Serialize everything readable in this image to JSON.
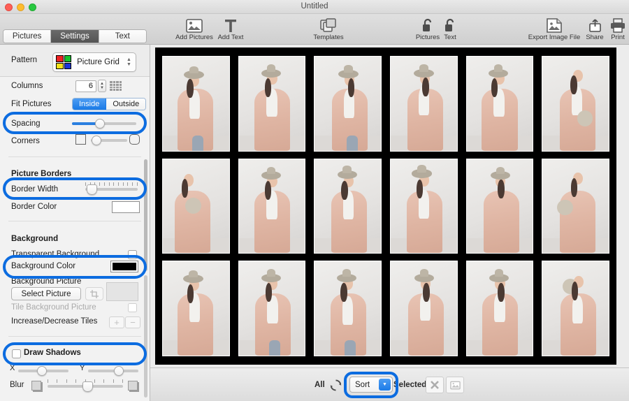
{
  "window": {
    "title": "Untitled",
    "traffic_lights": [
      "close",
      "minimize",
      "zoom"
    ]
  },
  "toolbar": {
    "items": [
      {
        "label": "Add Pictures",
        "icon": "picture-icon"
      },
      {
        "label": "Add Text",
        "icon": "text-t-icon"
      },
      {
        "label": "Templates",
        "icon": "templates-icon"
      },
      {
        "label": "Pictures",
        "icon": "unlock-icon"
      },
      {
        "label": "Text",
        "icon": "unlock-icon"
      },
      {
        "label": "Export Image File",
        "icon": "export-image-icon"
      },
      {
        "label": "Share",
        "icon": "share-icon"
      },
      {
        "label": "Print",
        "icon": "printer-icon"
      }
    ]
  },
  "sidebar": {
    "tabs": [
      {
        "label": "Pictures",
        "active": false
      },
      {
        "label": "Settings",
        "active": true
      },
      {
        "label": "Text",
        "active": false
      }
    ],
    "pattern": {
      "label": "Pattern",
      "value": "Picture Grid",
      "swatch_colors": [
        "#ee2222",
        "#15c22c",
        "#f5e21a",
        "#1d34d8"
      ]
    },
    "columns": {
      "label": "Columns",
      "value": "6"
    },
    "fit_pictures": {
      "label": "Fit Pictures",
      "options": [
        "Inside",
        "Outside"
      ],
      "selected": "Inside"
    },
    "spacing": {
      "label": "Spacing",
      "value_pct": 40,
      "highlighted": true
    },
    "corners": {
      "label": "Corners",
      "value_pct": 12
    },
    "picture_borders": {
      "heading": "Picture Borders",
      "border_width": {
        "label": "Border Width",
        "value_pct": 8,
        "highlighted": true
      },
      "border_color": {
        "label": "Border Color",
        "color": "#ffffff"
      }
    },
    "background": {
      "heading": "Background",
      "transparent": {
        "label": "Transparent Background",
        "checked": false
      },
      "color": {
        "label": "Background Color",
        "color": "#000000",
        "highlighted": true
      },
      "picture": {
        "label": "Background Picture",
        "button": "Select Picture",
        "crop_icon": "crop-icon"
      },
      "tile": {
        "label": "Tile Background Picture",
        "checked": false,
        "disabled": true
      },
      "tiles": {
        "label": "Increase/Decrease Tiles",
        "plus": "+",
        "minus": "−"
      }
    },
    "shadows": {
      "label": "Draw Shadows",
      "checked": false,
      "highlighted": true,
      "x": {
        "label": "X",
        "value_pct": 40
      },
      "y": {
        "label": "Y",
        "value_pct": 55
      },
      "blur": {
        "label": "Blur",
        "value_pct": 50
      }
    }
  },
  "canvas": {
    "background_color": "#000000",
    "columns": 6,
    "rows": 3,
    "photo_count": 18,
    "photos": [
      {
        "pose": "standing-side-left",
        "prop": "none"
      },
      {
        "pose": "hands-clasped",
        "prop": "none"
      },
      {
        "pose": "hand-to-hat",
        "prop": "none"
      },
      {
        "pose": "profile-right",
        "prop": "none"
      },
      {
        "pose": "arms-crossed",
        "prop": "none"
      },
      {
        "pose": "holding-hat-low",
        "prop": "hat"
      },
      {
        "pose": "hat-on-shoulder",
        "prop": "hat"
      },
      {
        "pose": "hands-down-front",
        "prop": "none"
      },
      {
        "pose": "touching-hat-brim",
        "prop": "none"
      },
      {
        "pose": "hand-on-hip",
        "prop": "none"
      },
      {
        "pose": "back-turned",
        "prop": "none"
      },
      {
        "pose": "holding-hat-chest",
        "prop": "hat"
      },
      {
        "pose": "hand-on-hip-lean",
        "prop": "none"
      },
      {
        "pose": "adjusting-hat",
        "prop": "none"
      },
      {
        "pose": "head-tilt",
        "prop": "none"
      },
      {
        "pose": "profile-pocket",
        "prop": "none"
      },
      {
        "pose": "hand-to-chin",
        "prop": "none"
      },
      {
        "pose": "hat-over-face",
        "prop": "hat"
      }
    ]
  },
  "bottombar": {
    "all_label": "All",
    "shuffle_icon": "shuffle-icon",
    "sort_label": "Sort",
    "sort_highlighted": true,
    "selected_label": "Selected",
    "remove_icon": "close-x-icon",
    "replace_icon": "replace-image-icon"
  },
  "colors": {
    "accent_blue": "#0c6ce0",
    "segment_blue": "#1a7ae6",
    "canvas_black": "#000000"
  }
}
